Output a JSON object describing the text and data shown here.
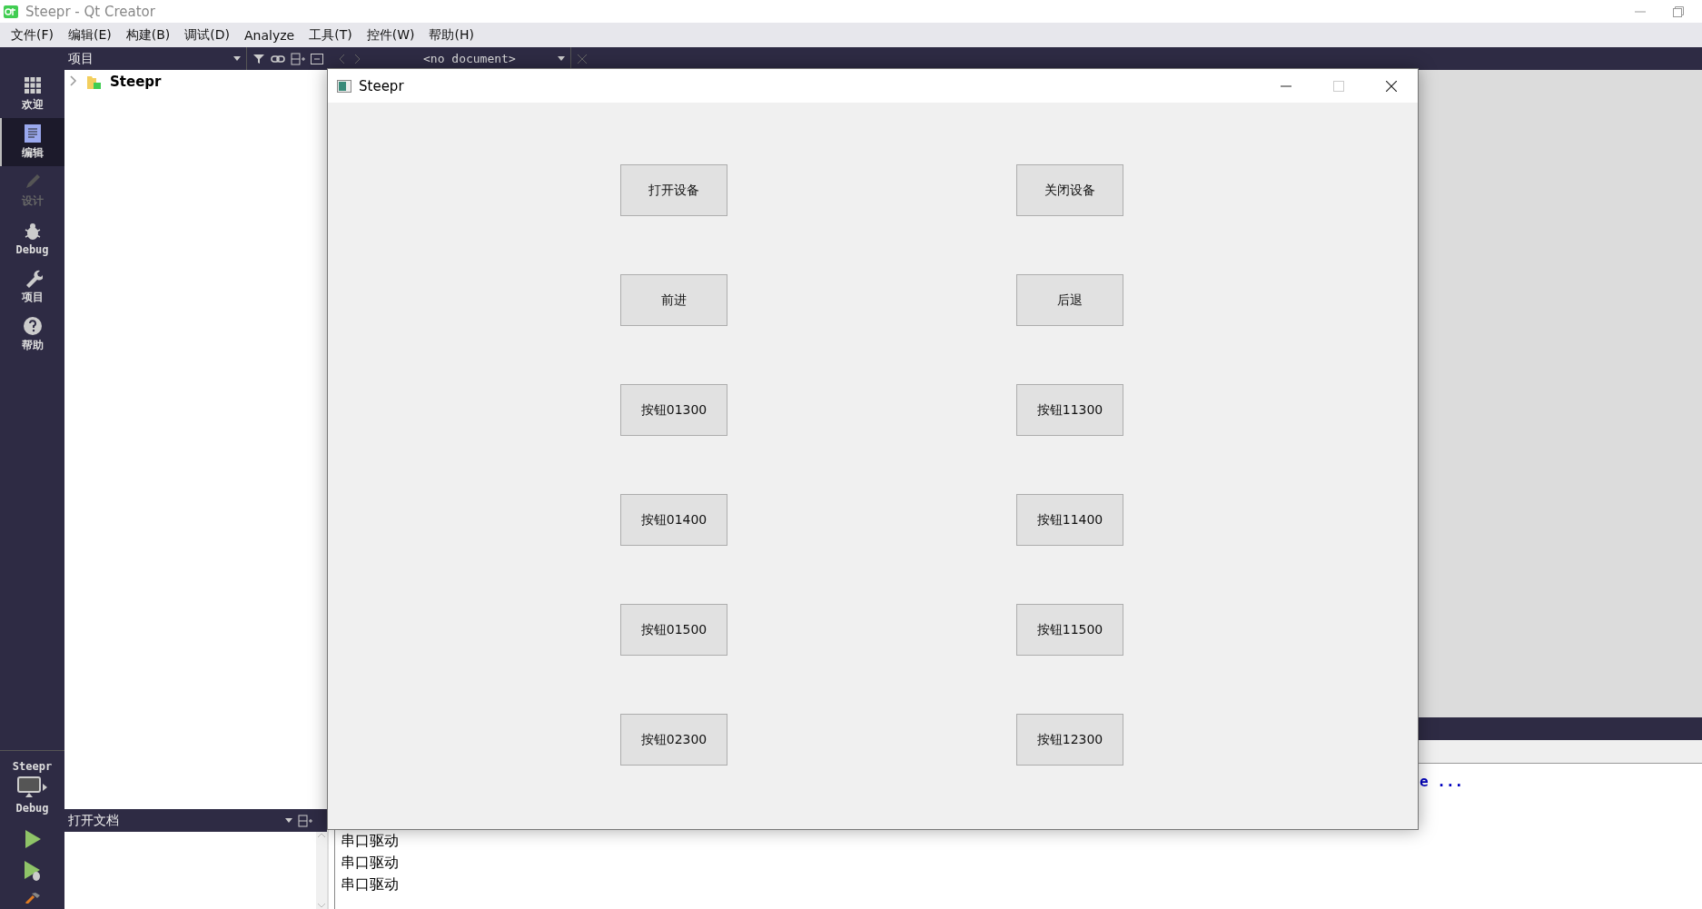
{
  "window": {
    "title": "Steepr - Qt Creator"
  },
  "menu": [
    "文件(F)",
    "编辑(E)",
    "构建(B)",
    "调试(D)",
    "Analyze",
    "工具(T)",
    "控件(W)",
    "帮助(H)"
  ],
  "modes": [
    {
      "label": "欢迎",
      "selected": false,
      "disabled": false
    },
    {
      "label": "编辑",
      "selected": true,
      "disabled": false
    },
    {
      "label": "设计",
      "selected": false,
      "disabled": true
    },
    {
      "label": "Debug",
      "selected": false,
      "disabled": false
    },
    {
      "label": "项目",
      "selected": false,
      "disabled": false
    },
    {
      "label": "帮助",
      "selected": false,
      "disabled": false
    }
  ],
  "target": {
    "project": "Steepr",
    "build": "Debug"
  },
  "projects_pane": {
    "title": "项目",
    "tree": [
      {
        "label": "Steepr",
        "expanded": false
      }
    ]
  },
  "editor_toolbar": {
    "document": "<no document>"
  },
  "open_documents": {
    "title": "打开文档"
  },
  "output": {
    "lines": [
      "e ...",
      "串口驱动",
      "串口驱动",
      "串口驱动"
    ]
  },
  "dialog": {
    "title": "Steepr",
    "buttons": [
      "打开设备",
      "关闭设备",
      "前进",
      "后退",
      "按钮01300",
      "按钮11300",
      "按钮01400",
      "按钮11400",
      "按钮01500",
      "按钮11500",
      "按钮02300",
      "按钮12300"
    ]
  }
}
